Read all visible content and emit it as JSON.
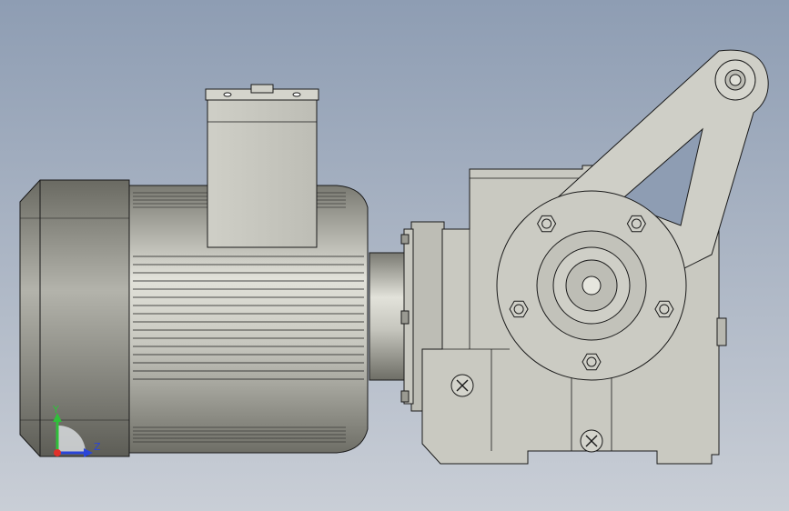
{
  "viewport": {
    "background_top": "#8e9db3",
    "background_bottom": "#c9ced6"
  },
  "model": {
    "body_color": "#c9c9c1",
    "body_shadow": "#9a9a92",
    "edge_color": "#1a1a1a",
    "motor": {
      "fin_count": 16
    },
    "gearbox": {
      "flange_bolt_count": 5
    }
  },
  "triad": {
    "y_label": "Y",
    "z_label": "Z",
    "x_color": "#e0302a",
    "y_color": "#2fbf3a",
    "z_color": "#2a45d8"
  }
}
